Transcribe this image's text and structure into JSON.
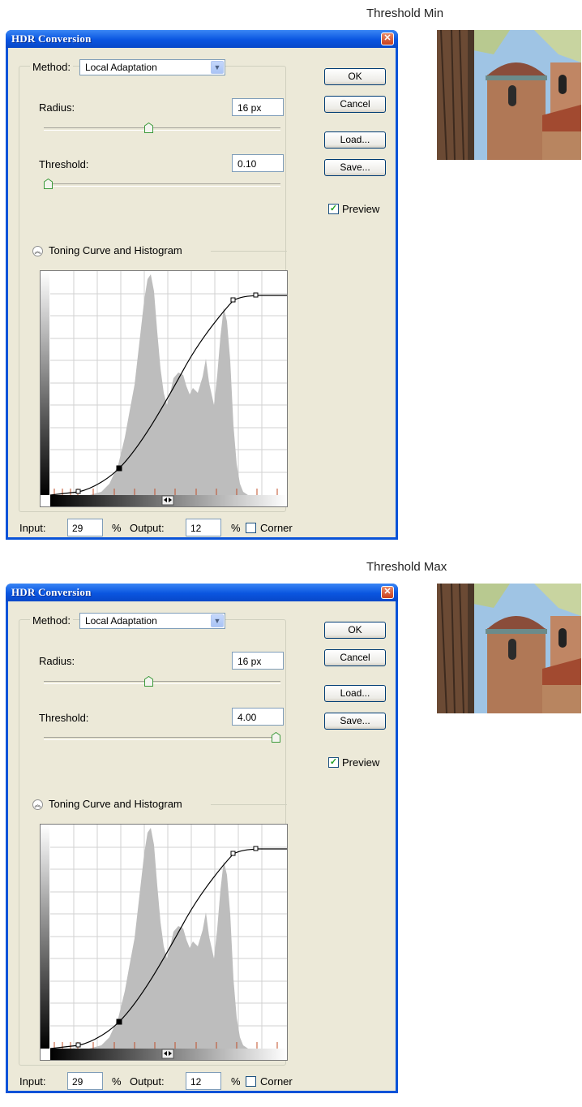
{
  "panels": [
    {
      "caption": "Threshold Min",
      "dialog": {
        "title": "HDR Conversion",
        "method_label": "Method:",
        "method_value": "Local Adaptation",
        "radius_label": "Radius:",
        "radius_value": "16 px",
        "radius_position": 0.44,
        "threshold_label": "Threshold:",
        "threshold_value": "0.10",
        "threshold_position": 0.0,
        "section_label": "Toning Curve and Histogram",
        "input_label": "Input:",
        "input_value": "29",
        "input_unit": "%",
        "output_label": "Output:",
        "output_value": "12",
        "output_unit": "%",
        "corner_label": "Corner",
        "corner_checked": false,
        "buttons": {
          "ok": "OK",
          "cancel": "Cancel",
          "load": "Load...",
          "save": "Save..."
        },
        "preview_label": "Preview",
        "preview_checked": true
      }
    },
    {
      "caption": "Threshold Max",
      "dialog": {
        "title": "HDR Conversion",
        "method_label": "Method:",
        "method_value": "Local Adaptation",
        "radius_label": "Radius:",
        "radius_value": "16 px",
        "radius_position": 0.44,
        "threshold_label": "Threshold:",
        "threshold_value": "4.00",
        "threshold_position": 1.0,
        "section_label": "Toning Curve and Histogram",
        "input_label": "Input:",
        "input_value": "29",
        "input_unit": "%",
        "output_label": "Output:",
        "output_value": "12",
        "output_unit": "%",
        "corner_label": "Corner",
        "corner_checked": false,
        "buttons": {
          "ok": "OK",
          "cancel": "Cancel",
          "load": "Load...",
          "save": "Save..."
        },
        "preview_label": "Preview",
        "preview_checked": true
      }
    }
  ],
  "icons": {
    "close": "close-icon",
    "dropdown": "chevron-down-icon",
    "collapse": "double-chevron-up-icon",
    "slider_thumb": "slider-thumb-icon",
    "check": "checkmark-icon"
  },
  "colors": {
    "title_bar": "#0a55e0",
    "dialog_face": "#ece9d8",
    "histogram": "#bdbdbd",
    "tick_marks": "#c0502a",
    "preview_check": "#21a121"
  },
  "toning_curve": {
    "input_output_points_percent": [
      [
        0,
        0
      ],
      [
        12,
        1
      ],
      [
        29,
        12
      ],
      [
        79,
        93
      ],
      [
        88,
        96
      ],
      [
        100,
        96
      ]
    ]
  }
}
